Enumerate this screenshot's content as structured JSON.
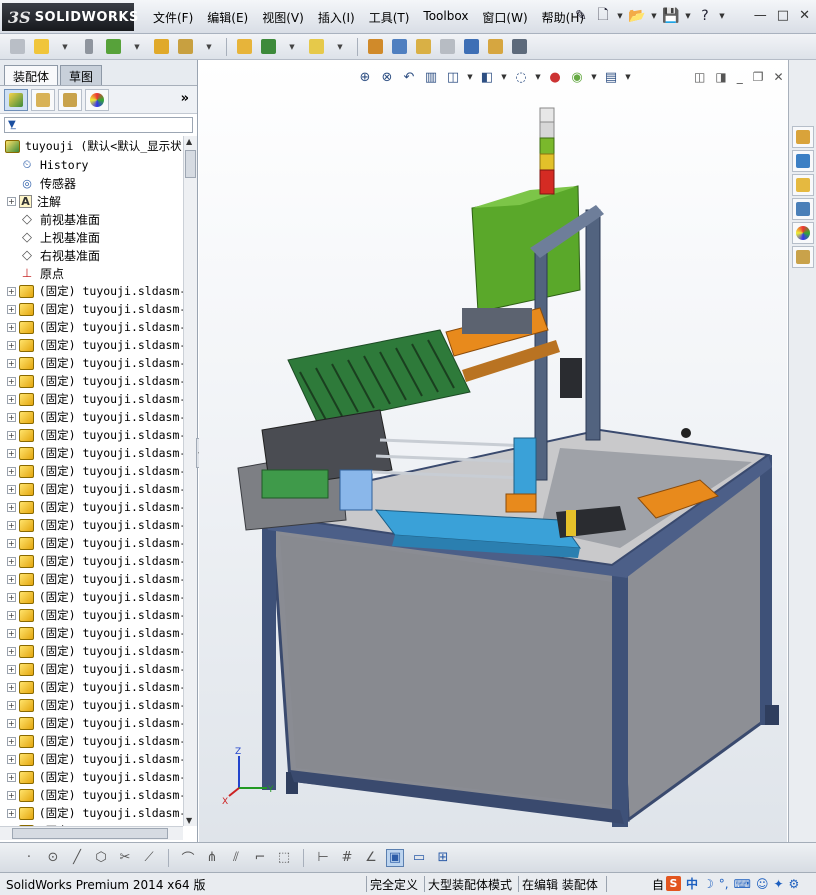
{
  "app": {
    "logo_ds": "3S",
    "logo_name": "SOLIDWORKS"
  },
  "menu": [
    "文件(F)",
    "编辑(E)",
    "视图(V)",
    "插入(I)",
    "工具(T)",
    "Toolbox",
    "窗口(W)",
    "帮助(H)"
  ],
  "window_controls": [
    "—",
    "□",
    "✕"
  ],
  "left_tabs": {
    "active": "装配体",
    "inactive": "草图"
  },
  "tree": {
    "root": "tuyouji  (默认<默认_显示状",
    "items": [
      {
        "label": "History",
        "icon": "history-icon"
      },
      {
        "label": "传感器",
        "icon": "sensor-icon"
      },
      {
        "label": "注解",
        "icon": "annotation-icon"
      },
      {
        "label": "前视基准面",
        "icon": "plane-icon"
      },
      {
        "label": "上视基准面",
        "icon": "plane-icon"
      },
      {
        "label": "右视基准面",
        "icon": "plane-icon"
      },
      {
        "label": "原点",
        "icon": "origin-icon"
      }
    ],
    "component_label": "(固定) tuyouji.sldasm-P",
    "component_count": 31
  },
  "status": {
    "product": "SolidWorks Premium 2014 x64 版",
    "defined": "完全定义",
    "mode": "大型装配体模式",
    "editing": "在编辑 装配体",
    "custom": "自",
    "ime_cn": "中"
  },
  "colors": {
    "frame": "#3a4a6e",
    "panel_gray": "#8d8f95",
    "green_box": "#5aa82a",
    "blue_part": "#3aa1d8",
    "orange_part": "#e88a1c"
  }
}
